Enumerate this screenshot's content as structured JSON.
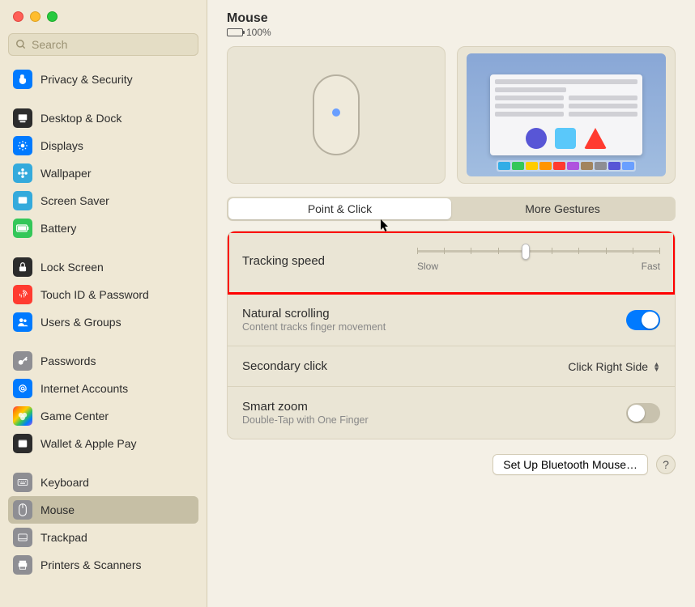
{
  "search": {
    "placeholder": "Search"
  },
  "sidebar": {
    "groups": [
      {
        "items": [
          {
            "label": "Privacy & Security",
            "icon": "hand-icon",
            "bg": "bg-blue"
          }
        ]
      },
      {
        "items": [
          {
            "label": "Desktop & Dock",
            "icon": "dock-icon",
            "bg": "bg-black"
          },
          {
            "label": "Displays",
            "icon": "sun-icon",
            "bg": "bg-blue"
          },
          {
            "label": "Wallpaper",
            "icon": "flower-icon",
            "bg": "bg-cyan"
          },
          {
            "label": "Screen Saver",
            "icon": "screensaver-icon",
            "bg": "bg-cyan"
          },
          {
            "label": "Battery",
            "icon": "battery-icon",
            "bg": "bg-green"
          }
        ]
      },
      {
        "items": [
          {
            "label": "Lock Screen",
            "icon": "lock-icon",
            "bg": "bg-black"
          },
          {
            "label": "Touch ID & Password",
            "icon": "fingerprint-icon",
            "bg": "bg-red"
          },
          {
            "label": "Users & Groups",
            "icon": "users-icon",
            "bg": "bg-blue"
          }
        ]
      },
      {
        "items": [
          {
            "label": "Passwords",
            "icon": "key-icon",
            "bg": "bg-grey"
          },
          {
            "label": "Internet Accounts",
            "icon": "at-icon",
            "bg": "bg-blue"
          },
          {
            "label": "Game Center",
            "icon": "gamecenter-icon",
            "bg": "bg-multi"
          },
          {
            "label": "Wallet & Apple Pay",
            "icon": "wallet-icon",
            "bg": "bg-black"
          }
        ]
      },
      {
        "items": [
          {
            "label": "Keyboard",
            "icon": "keyboard-icon",
            "bg": "bg-grey"
          },
          {
            "label": "Mouse",
            "icon": "mouse-icon",
            "bg": "bg-grey",
            "selected": true
          },
          {
            "label": "Trackpad",
            "icon": "trackpad-icon",
            "bg": "bg-grey"
          },
          {
            "label": "Printers & Scanners",
            "icon": "printer-icon",
            "bg": "bg-grey"
          }
        ]
      }
    ]
  },
  "header": {
    "title": "Mouse",
    "battery_percent": "100%"
  },
  "tabs": {
    "items": [
      "Point & Click",
      "More Gestures"
    ],
    "active": 0
  },
  "rows": {
    "tracking": {
      "title": "Tracking speed",
      "min_label": "Slow",
      "max_label": "Fast",
      "ticks": 10,
      "value_index": 4
    },
    "natural": {
      "title": "Natural scrolling",
      "subtitle": "Content tracks finger movement",
      "on": true
    },
    "secondary": {
      "title": "Secondary click",
      "value": "Click Right Side"
    },
    "zoom": {
      "title": "Smart zoom",
      "subtitle": "Double-Tap with One Finger",
      "on": false
    }
  },
  "footer": {
    "setup_button": "Set Up Bluetooth Mouse…",
    "help": "?"
  },
  "dock_colors": [
    "#32ade6",
    "#34c759",
    "#ffcc00",
    "#ff9500",
    "#ff3b30",
    "#af52de",
    "#a2845e",
    "#8e8e93",
    "#5856d6",
    "#6a9fff"
  ]
}
